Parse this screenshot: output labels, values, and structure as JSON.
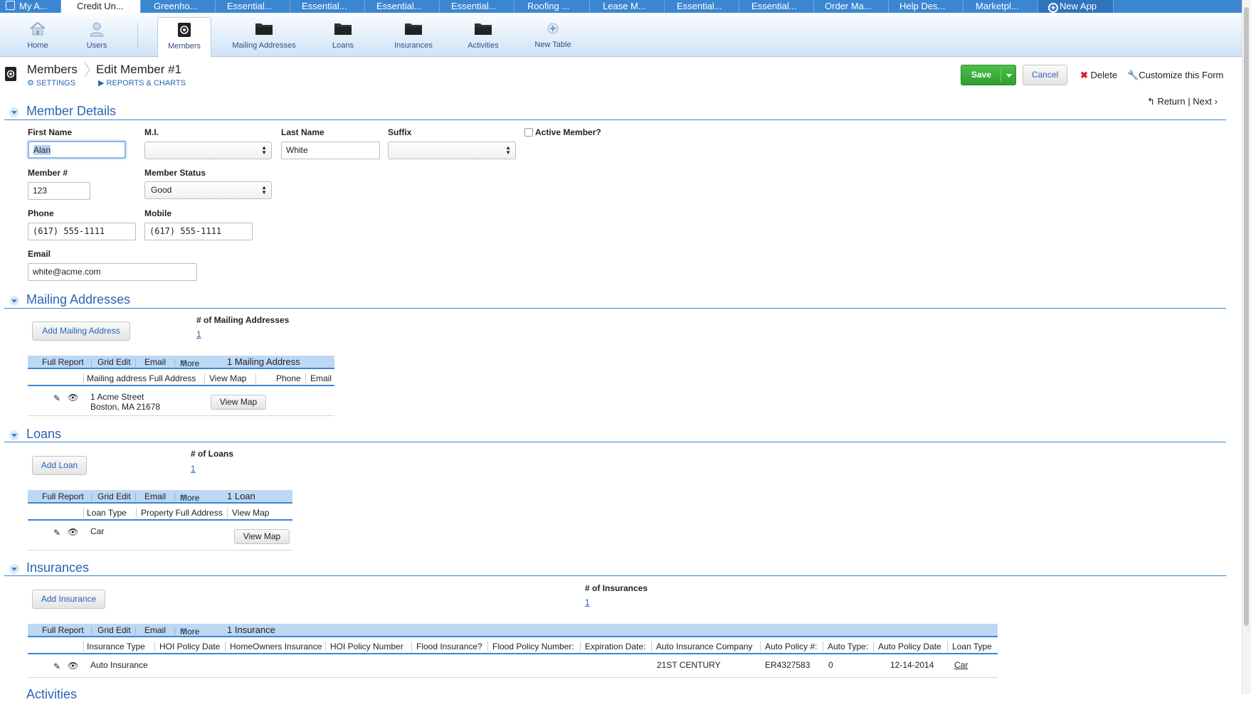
{
  "app_tabs": [
    "My A...",
    "Credit Un...",
    "Greenho...",
    "Essential...",
    "Essential...",
    "Essential...",
    "Essential...",
    "Roofing ...",
    "Lease M...",
    "Essential...",
    "Essential...",
    "Order Ma...",
    "Help Des...",
    "Marketpl...",
    "New App"
  ],
  "toolbar": {
    "items": [
      "Home",
      "Users",
      "Members",
      "Mailing Addresses",
      "Loans",
      "Insurances",
      "Activities",
      "New Table"
    ]
  },
  "breadcrumb": {
    "table": "Members",
    "settings": "SETTINGS",
    "page": "Edit Member #1",
    "reports": "REPORTS & CHARTS"
  },
  "actions": {
    "save": "Save",
    "cancel": "Cancel",
    "delete": "Delete",
    "customize": "Customize this Form",
    "return": "Return",
    "next": "Next"
  },
  "member_details": {
    "title": "Member Details",
    "first_name_label": "First Name",
    "first_name": "Alan",
    "mi_label": "M.I.",
    "mi": "",
    "last_name_label": "Last Name",
    "last_name": "White",
    "suffix_label": "Suffix",
    "suffix": "",
    "active_label": "Active Member?",
    "member_no_label": "Member #",
    "member_no": "123",
    "status_label": "Member Status",
    "status": "Good",
    "phone_label": "Phone",
    "phone": "(617) 555-1111",
    "mobile_label": "Mobile",
    "mobile": "(617) 555-1111",
    "email_label": "Email",
    "email": "white@acme.com"
  },
  "grid_toolbar": {
    "full_report": "Full Report",
    "grid_edit": "Grid Edit",
    "email": "Email",
    "more": "More"
  },
  "mailing": {
    "title": "Mailing Addresses",
    "add": "Add  Mailing Address",
    "count_label": "# of Mailing Addresses",
    "count": "1",
    "summary": "1 Mailing Address",
    "columns": [
      "Mailing address Full Address",
      "View Map",
      "Phone",
      "Email"
    ],
    "row": {
      "line1": "1 Acme Street",
      "line2": "Boston, MA 21678",
      "map": "View Map"
    }
  },
  "loans": {
    "title": "Loans",
    "add": "Add  Loan",
    "count_label": "# of Loans",
    "count": "1",
    "summary": "1 Loan",
    "columns": [
      "Loan Type",
      "Property Full Address",
      "View Map"
    ],
    "row": {
      "type": "Car",
      "map": "View Map"
    }
  },
  "insurances": {
    "title": "Insurances",
    "add": "Add  Insurance",
    "count_label": "# of Insurances",
    "count": "1",
    "summary": "1 Insurance",
    "columns": [
      "Insurance Type",
      "HOI Policy Date",
      "HomeOwners Insurance",
      "HOI Policy Number",
      "Flood Insurance?",
      "Flood Policy Number:",
      "Expiration Date:",
      "Auto Insurance Company",
      "Auto Policy #:",
      "Auto Type:",
      "Auto Policy Date",
      "Loan Type"
    ],
    "row": {
      "type": "Auto Insurance",
      "company": "21ST CENTURY",
      "policy": "ER4327583",
      "auto_type": "0",
      "date": "12-14-2014",
      "loan_type": "Car"
    }
  },
  "activities": {
    "title": "Activities"
  }
}
